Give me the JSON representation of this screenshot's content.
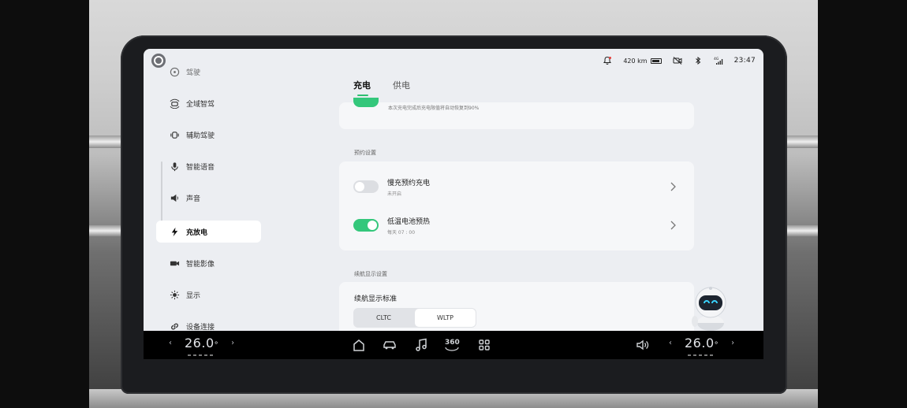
{
  "status_bar": {
    "range": "420 km",
    "time": "23:47",
    "icons": [
      "bell-icon",
      "battery-icon",
      "camera-off-icon",
      "bluetooth-icon",
      "signal-4g-icon"
    ]
  },
  "sidebar": {
    "items": [
      {
        "label": "驾驶",
        "icon": "steering-wheel-icon"
      },
      {
        "label": "全域智驾",
        "icon": "car-radar-icon"
      },
      {
        "label": "辅助驾驶",
        "icon": "driver-assist-icon"
      },
      {
        "label": "智能语音",
        "icon": "microphone-icon"
      },
      {
        "label": "声音",
        "icon": "speaker-icon"
      },
      {
        "label": "充放电",
        "icon": "lightning-icon",
        "active": true
      },
      {
        "label": "智能影像",
        "icon": "video-camera-icon"
      },
      {
        "label": "显示",
        "icon": "sun-icon"
      },
      {
        "label": "设备连接",
        "icon": "link-icon"
      }
    ]
  },
  "tabs": [
    {
      "label": "充电",
      "active": true
    },
    {
      "label": "供电",
      "active": false
    }
  ],
  "charge_card": {
    "note": "本次充电完成后充电限值将自动恢复到90%"
  },
  "schedule_section": {
    "title": "预约设置",
    "rows": [
      {
        "title": "慢充预约充电",
        "subtitle": "未开启",
        "enabled": false
      },
      {
        "title": "低温电池预热",
        "subtitle": "每天 07 : 00",
        "enabled": true
      }
    ]
  },
  "range_section": {
    "title": "续航显示设置",
    "label": "续航显示标准",
    "options": [
      "CLTC",
      "WLTP"
    ],
    "selected": "WLTP"
  },
  "dock": {
    "left_temp": "26.0",
    "right_temp": "26.0",
    "degree": "°",
    "icons": [
      "home-icon",
      "car-icon",
      "music-icon",
      "camera-360-icon",
      "apps-grid-icon",
      "volume-icon"
    ],
    "view_360_label": "360"
  },
  "colors": {
    "accent_green": "#34c77b",
    "screen_bg": "#eceef2",
    "card_bg": "#f6f7f9"
  }
}
